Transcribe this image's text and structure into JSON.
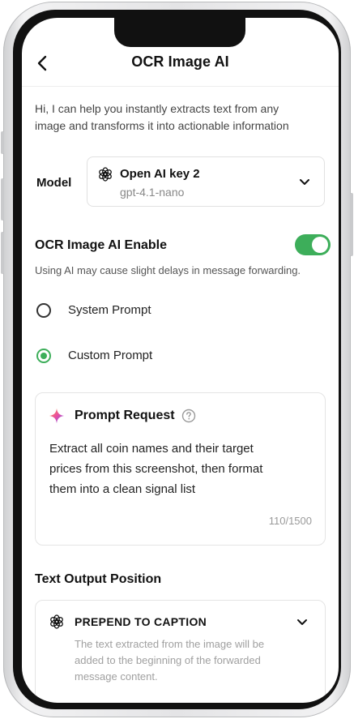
{
  "header": {
    "title": "OCR Image AI"
  },
  "intro": {
    "line1": "Hi, I can help you  instantly extracts text from any",
    "line2": "image and transforms it into actionable information"
  },
  "model": {
    "label": "Model",
    "selected_name": "Open AI key 2",
    "selected_model": "gpt-4.1-nano"
  },
  "enable": {
    "title": "OCR Image AI Enable",
    "on": true,
    "note": "Using AI may cause slight delays in message forwarding."
  },
  "prompt_type": {
    "options": [
      {
        "label": "System Prompt",
        "selected": false
      },
      {
        "label": "Custom Prompt",
        "selected": true
      }
    ]
  },
  "prompt_request": {
    "title": "Prompt Request",
    "text_line1": "Extract all coin names and their target",
    "text_line2": "prices from this screenshot, then format",
    "text_line3": "them into a clean signal list",
    "counter": "110/1500"
  },
  "output": {
    "title": "Text Output Position",
    "value": "PREPEND TO CAPTION",
    "desc_line1": "The text extracted from the image will be",
    "desc_line2": "added to the beginning of the forwarded",
    "desc_line3": "message content."
  },
  "colors": {
    "accent": "#3dae5a",
    "text": "#111111",
    "muted": "#888888"
  },
  "icons": [
    "back-arrow-icon",
    "openai-icon",
    "chevron-down-icon",
    "sparkle-icon",
    "help-icon"
  ]
}
